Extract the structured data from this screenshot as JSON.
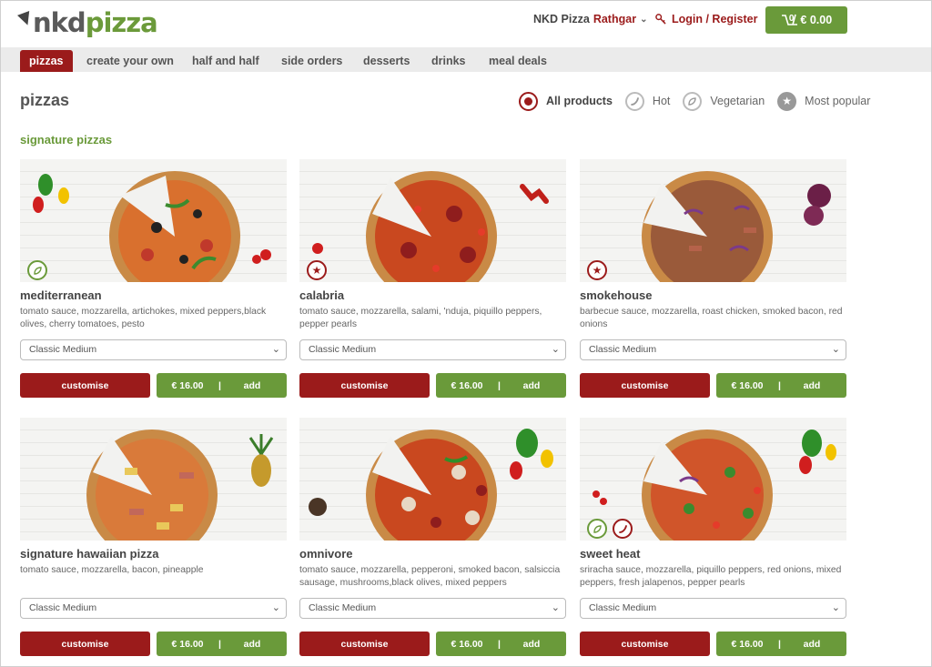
{
  "header": {
    "logo_nkd": "nkd",
    "logo_pizza": "pizza",
    "store_brand": "NKD Pizza",
    "store_location": "Rathgar",
    "login_label": "Login / Register",
    "cart_count": "0",
    "cart_total": "€ 0.00"
  },
  "nav": {
    "tabs": [
      {
        "label": "pizzas"
      },
      {
        "label": "create your own"
      },
      {
        "label": "half and half"
      },
      {
        "label": "side orders"
      },
      {
        "label": "desserts"
      },
      {
        "label": "drinks"
      },
      {
        "label": "meal deals"
      }
    ],
    "active": "pizzas"
  },
  "page": {
    "title": "pizzas",
    "section_title": "signature pizzas"
  },
  "filters": [
    {
      "label": "All products",
      "icon": "radio-selected-icon",
      "selected": true
    },
    {
      "label": "Hot",
      "icon": "chili-icon",
      "selected": false
    },
    {
      "label": "Vegetarian",
      "icon": "leaf-icon",
      "selected": false
    },
    {
      "label": "Most popular",
      "icon": "star-icon",
      "selected": false
    }
  ],
  "products": [
    {
      "name": "mediterranean",
      "description": "tomato sauce, mozzarella, artichokes, mixed peppers,black olives, cherry tomatoes, pesto",
      "size": "Classic Medium",
      "customise_label": "customise",
      "price": "€ 16.00",
      "add_label": "add",
      "badges": [
        "leaf-icon"
      ]
    },
    {
      "name": "calabria",
      "description": "tomato sauce, mozzarella, salami, 'nduja, piquillo peppers, pepper pearls",
      "size": "Classic Medium",
      "customise_label": "customise",
      "price": "€ 16.00",
      "add_label": "add",
      "badges": [
        "star-icon"
      ]
    },
    {
      "name": "smokehouse",
      "description": "barbecue sauce, mozzarella, roast chicken, smoked bacon, red onions",
      "size": "Classic Medium",
      "customise_label": "customise",
      "price": "€ 16.00",
      "add_label": "add",
      "badges": [
        "star-icon"
      ]
    },
    {
      "name": "signature hawaiian pizza",
      "description": "tomato sauce, mozzarella, bacon, pineapple",
      "size": "Classic Medium",
      "customise_label": "customise",
      "price": "€ 16.00",
      "add_label": "add",
      "badges": []
    },
    {
      "name": "omnivore",
      "description": "tomato sauce, mozzarella, pepperoni, smoked bacon, salsiccia sausage, mushrooms,black olives, mixed peppers",
      "size": "Classic Medium",
      "customise_label": "customise",
      "price": "€ 16.00",
      "add_label": "add",
      "badges": []
    },
    {
      "name": "sweet heat",
      "description": "sriracha sauce, mozzarella, piquillo peppers, red onions, mixed peppers, fresh jalapenos, pepper pearls",
      "size": "Classic Medium",
      "customise_label": "customise",
      "price": "€ 16.00",
      "add_label": "add",
      "badges": [
        "leaf-icon",
        "chili-icon"
      ]
    }
  ],
  "colors": {
    "brand_red": "#9b1b1b",
    "brand_green": "#6a9a3a",
    "nav_bg": "#ebebeb"
  }
}
